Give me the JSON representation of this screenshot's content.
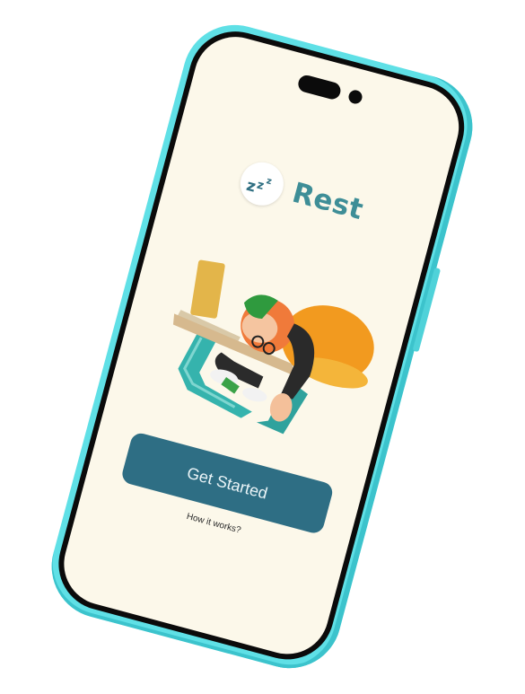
{
  "app": {
    "brand_name": "Rest",
    "logo_icon": "zzz-sleep-icon",
    "illustration": "person-sleeping-at-desk-illustration"
  },
  "actions": {
    "get_started_label": "Get Started",
    "how_it_works_label": "How it works?"
  },
  "colors": {
    "phone_frame": "#5fe0e6",
    "screen_bg": "#fcf8ea",
    "brand_text": "#3e8e97",
    "primary_button": "#2e6e84",
    "logo_z": "#2f6f82"
  }
}
